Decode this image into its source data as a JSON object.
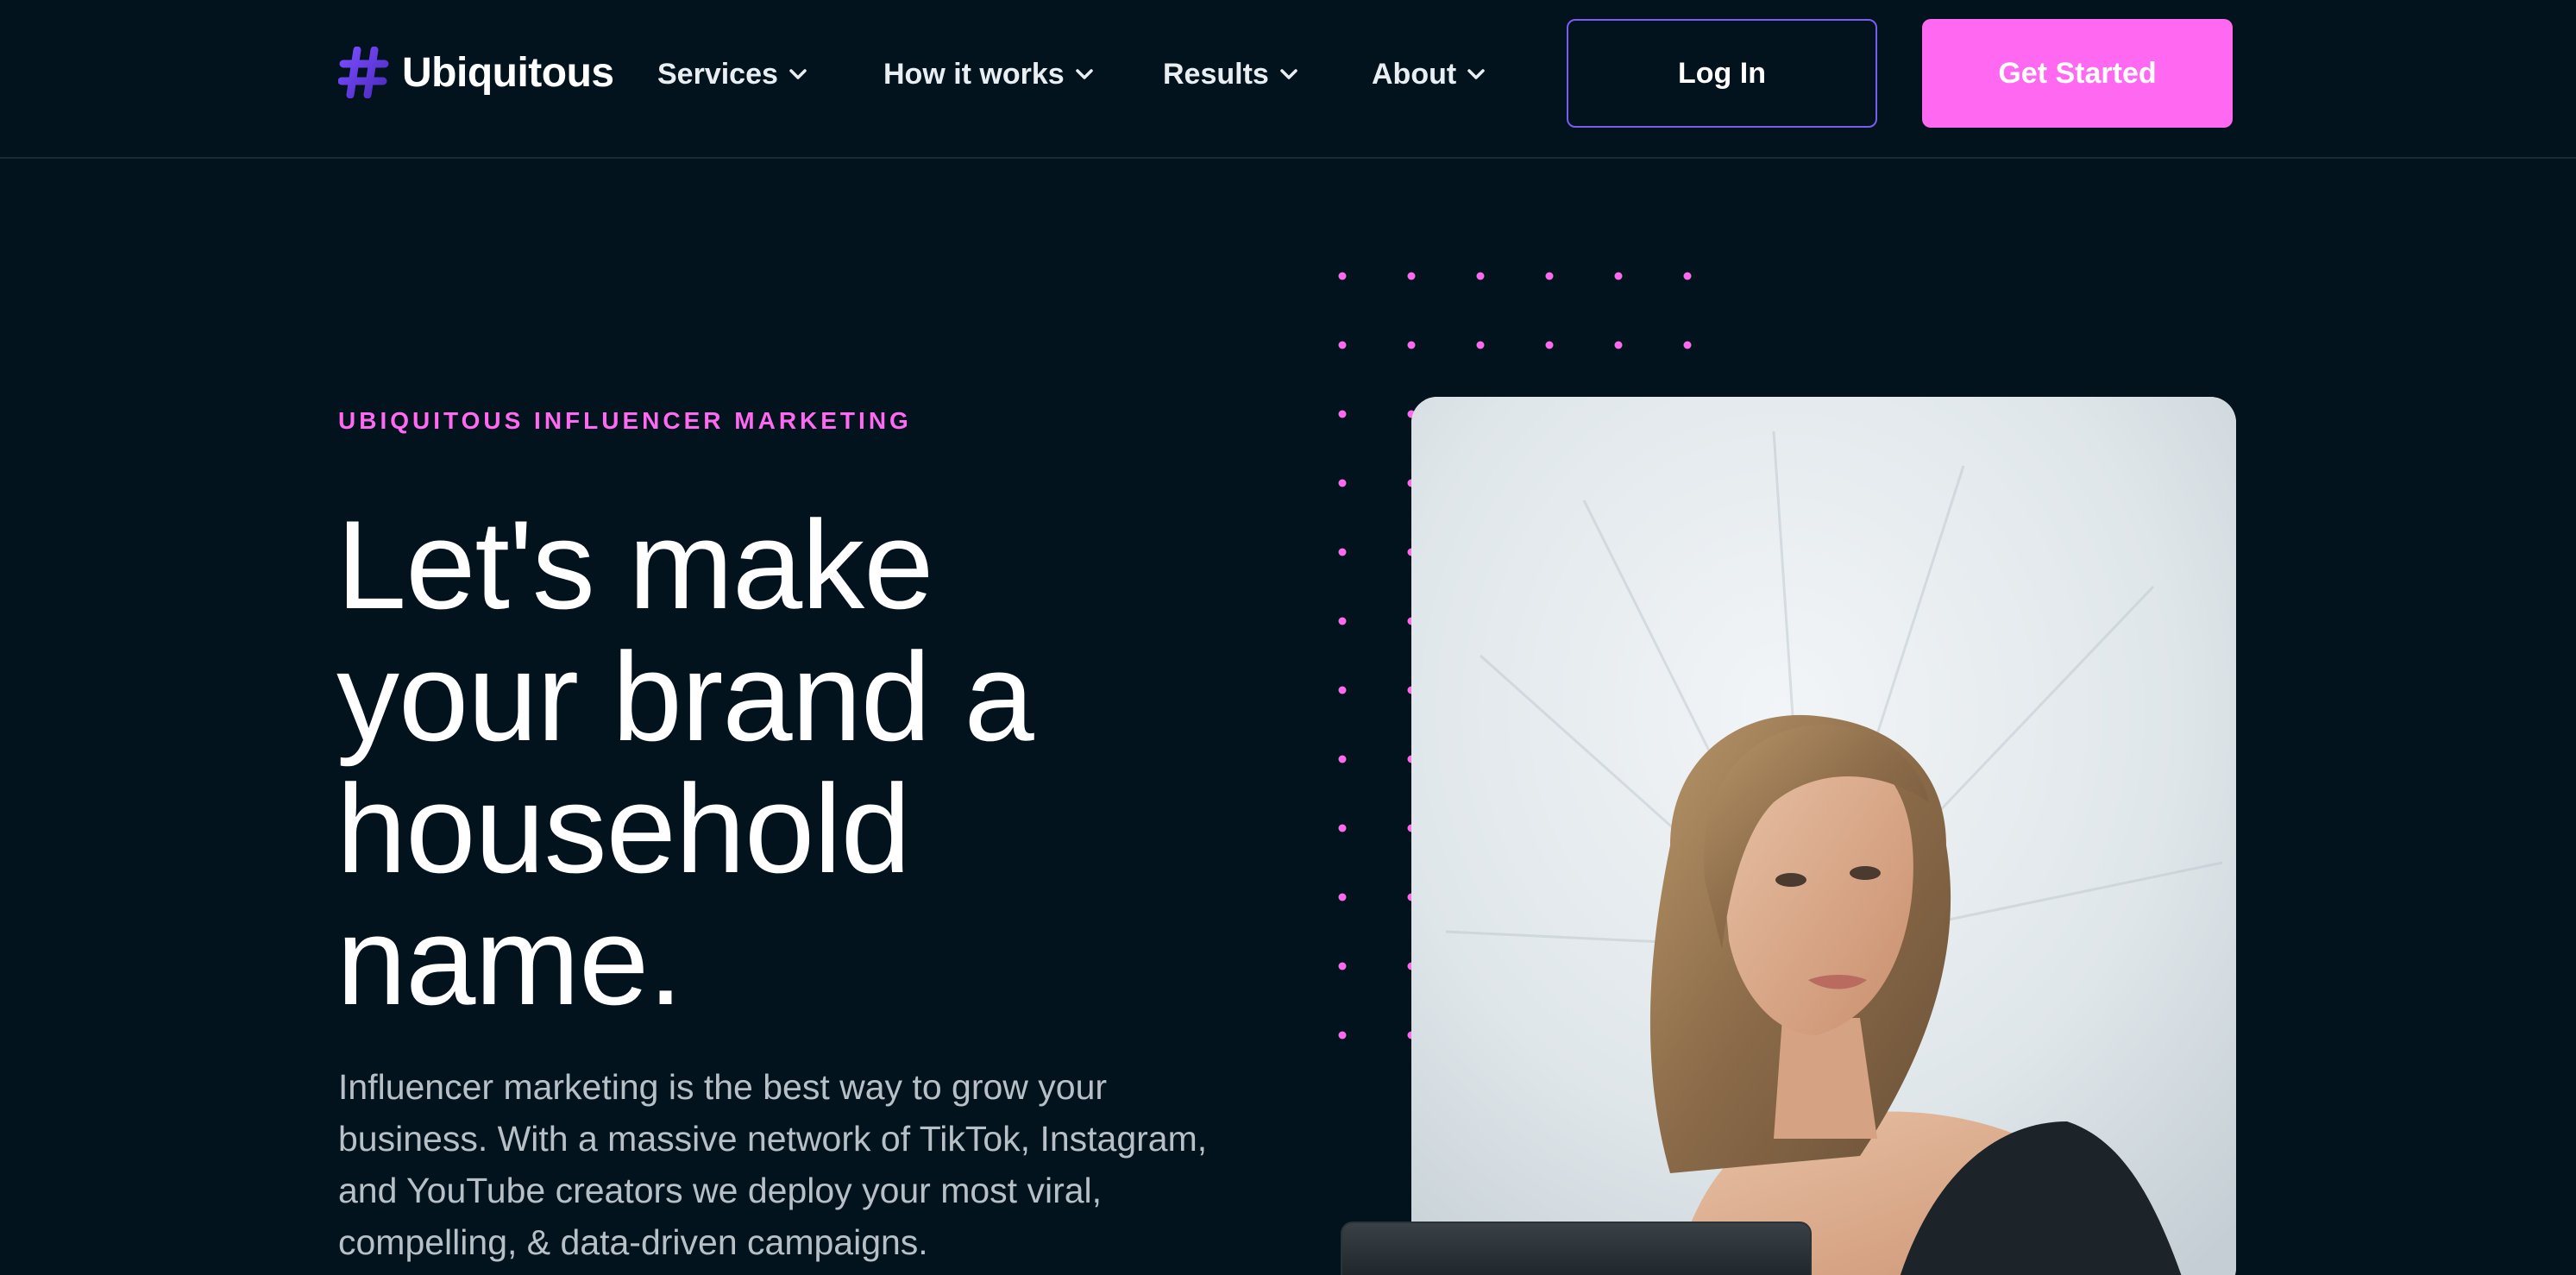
{
  "brand": {
    "name": "Ubiquitous",
    "logo_icon": "hash-icon",
    "colors": {
      "accent_pink": "#ff68f0",
      "accent_purple": "#7b5cf0",
      "background": "#02131d"
    }
  },
  "nav": {
    "items": [
      {
        "label": "Services",
        "icon": "chevron-down-icon"
      },
      {
        "label": "How it works",
        "icon": "chevron-down-icon"
      },
      {
        "label": "Results",
        "icon": "chevron-down-icon"
      },
      {
        "label": "About",
        "icon": "chevron-down-icon"
      }
    ],
    "login_label": "Log In",
    "cta_label": "Get Started"
  },
  "hero": {
    "eyebrow": "UBIQUITOUS INFLUENCER MARKETING",
    "headline": "Let's make your brand a household name.",
    "subtext": "Influencer marketing is the best way to grow your business. With a massive network of TikTok, Instagram, and YouTube creators we deploy your most viral, compelling, & data-driven campaigns."
  }
}
